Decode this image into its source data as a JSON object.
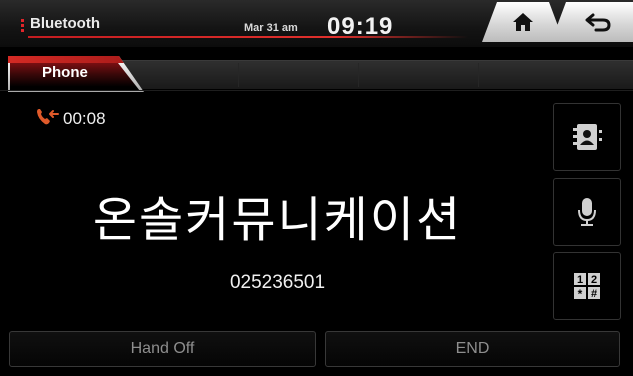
{
  "header": {
    "app_title": "Bluetooth",
    "date": "Mar 31 am",
    "time": "09:19",
    "home_icon": "home-icon",
    "back_icon": "back-arrow-icon"
  },
  "tabs": [
    {
      "label": "Phone",
      "active": true
    }
  ],
  "call": {
    "status_icon": "outgoing-call-icon",
    "duration": "00:08",
    "caller_name": "온솔커뮤니케이션",
    "caller_number": "025236501"
  },
  "side_buttons": [
    {
      "icon": "contacts-icon"
    },
    {
      "icon": "microphone-icon"
    },
    {
      "icon": "dialpad-icon",
      "glyphs": [
        "1",
        "2",
        "*",
        "#"
      ]
    }
  ],
  "actions": {
    "hand_off_label": "Hand Off",
    "end_label": "END"
  },
  "colors": {
    "accent": "#d42a24",
    "background": "#000000",
    "button_text": "#8e8e8e"
  }
}
